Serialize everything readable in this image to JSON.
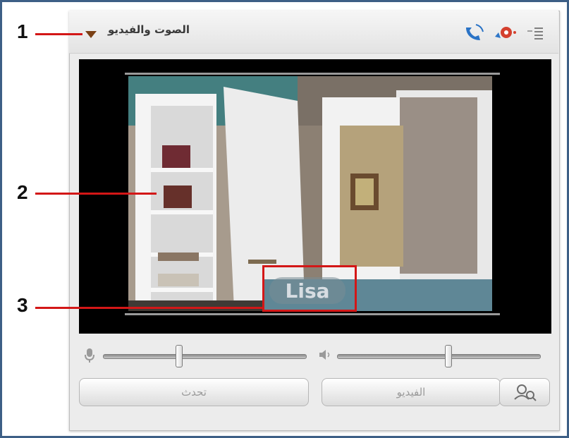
{
  "panel": {
    "title": "الصوت والفيديو",
    "icons": [
      "list-menu-icon",
      "settings-gear-icon",
      "phone-call-icon"
    ]
  },
  "video": {
    "participant_name": "Lisa"
  },
  "controls": {
    "microphone_level": 0.26,
    "speaker_level": 0.54,
    "talk_button": "تحدث",
    "video_button": "الفيديو"
  },
  "annotations": {
    "labels": [
      "1",
      "2",
      "3"
    ]
  },
  "colors": {
    "annotation_red": "#d31717",
    "frame_blue": "#3d5f86"
  }
}
